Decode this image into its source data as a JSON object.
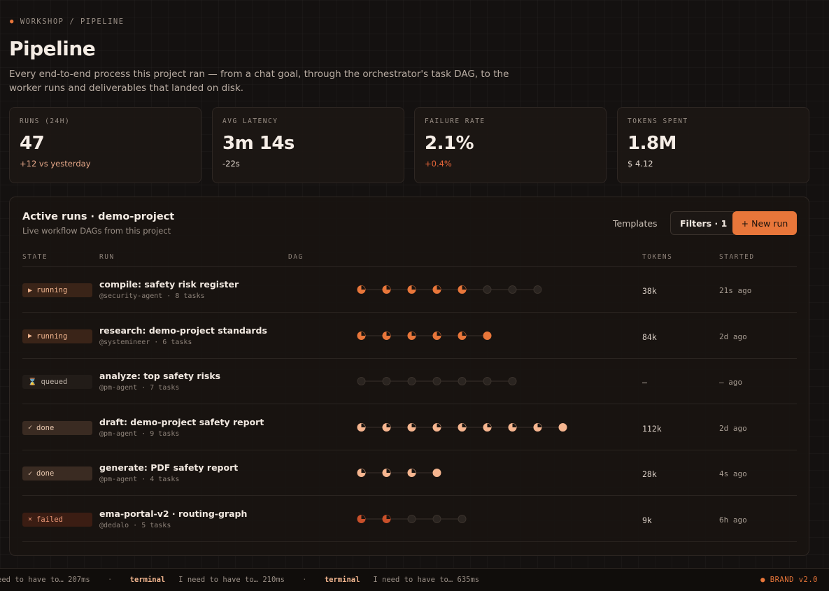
{
  "breadcrumb": "WORKSHOP / PIPELINE",
  "title": "Pipeline",
  "description": "Every end-to-end process this project ran — from a chat goal, through the orchestrator's task DAG, to the worker runs and deliverables that landed on disk.",
  "stats": [
    {
      "label": "RUNS (24H)",
      "value": "47",
      "delta": "+12 vs yesterday"
    },
    {
      "label": "AVG LATENCY",
      "value": "3m 14s",
      "delta": "-22s"
    },
    {
      "label": "FAILURE RATE",
      "value": "2.1%",
      "delta": "+0.4%"
    },
    {
      "label": "TOKENS SPENT",
      "value": "1.8M",
      "delta": "$ 4.12"
    }
  ],
  "panel": {
    "title": "Active runs · demo-project",
    "subtitle": "Live workflow DAGs from this project",
    "templates_label": "Templates",
    "filters_label": "Filters · 1",
    "new_run_label": "+ New run"
  },
  "columns": {
    "state": "STATE",
    "run": "RUN",
    "dag": "DAG",
    "tokens": "TOKENS",
    "started": "STARTED"
  },
  "runs": [
    {
      "state": "running",
      "icon": "▶",
      "title": "compile: safety risk register",
      "meta": "@security-agent · 8 tasks",
      "tokens": "38k",
      "started": "21s ago",
      "dag": [
        "half",
        "half",
        "half",
        "half",
        "half",
        "pending",
        "pending",
        "pending"
      ]
    },
    {
      "state": "running",
      "icon": "▶",
      "title": "research: demo-project standards",
      "meta": "@systemineer · 6 tasks",
      "tokens": "84k",
      "started": "2d ago",
      "dag": [
        "half",
        "half",
        "half",
        "half",
        "half",
        "active"
      ]
    },
    {
      "state": "queued",
      "icon": "⌛",
      "title": "analyze: top safety risks",
      "meta": "@pm-agent · 7 tasks",
      "tokens": "–",
      "started": "– ago",
      "dag": [
        "pending",
        "pending",
        "pending",
        "pending",
        "pending",
        "pending",
        "pending"
      ]
    },
    {
      "state": "done",
      "icon": "✓",
      "title": "draft: demo-project safety report",
      "meta": "@pm-agent · 9 tasks",
      "tokens": "112k",
      "started": "2d ago",
      "dag": [
        "light-half",
        "light-half",
        "light-half",
        "light-half",
        "light-half",
        "light-half",
        "light-half",
        "light-half",
        "light-full"
      ]
    },
    {
      "state": "done",
      "icon": "✓",
      "title": "generate: PDF safety report",
      "meta": "@pm-agent · 4 tasks",
      "tokens": "28k",
      "started": "4s ago",
      "dag": [
        "light-half",
        "light-half",
        "light-half",
        "light-full"
      ]
    },
    {
      "state": "failed",
      "icon": "✕",
      "title": "ema-portal-v2 · routing-graph",
      "meta": "@dedalo · 5 tasks",
      "tokens": "9k",
      "started": "6h ago",
      "dag": [
        "fail-half",
        "fail-half",
        "pending",
        "pending",
        "pending"
      ]
    }
  ],
  "ticker": [
    {
      "text": "eed to have to… 207ms"
    },
    {
      "tag": "terminal",
      "text": "I need to have to… 210ms"
    },
    {
      "tag": "terminal",
      "text": "I need to have to… 635ms"
    }
  ],
  "brand": "● BRAND v2.0",
  "colors": {
    "accent": "#e8763a",
    "light": "#f5b58f",
    "fail": "#c9502a",
    "pending": "#2a2420"
  }
}
